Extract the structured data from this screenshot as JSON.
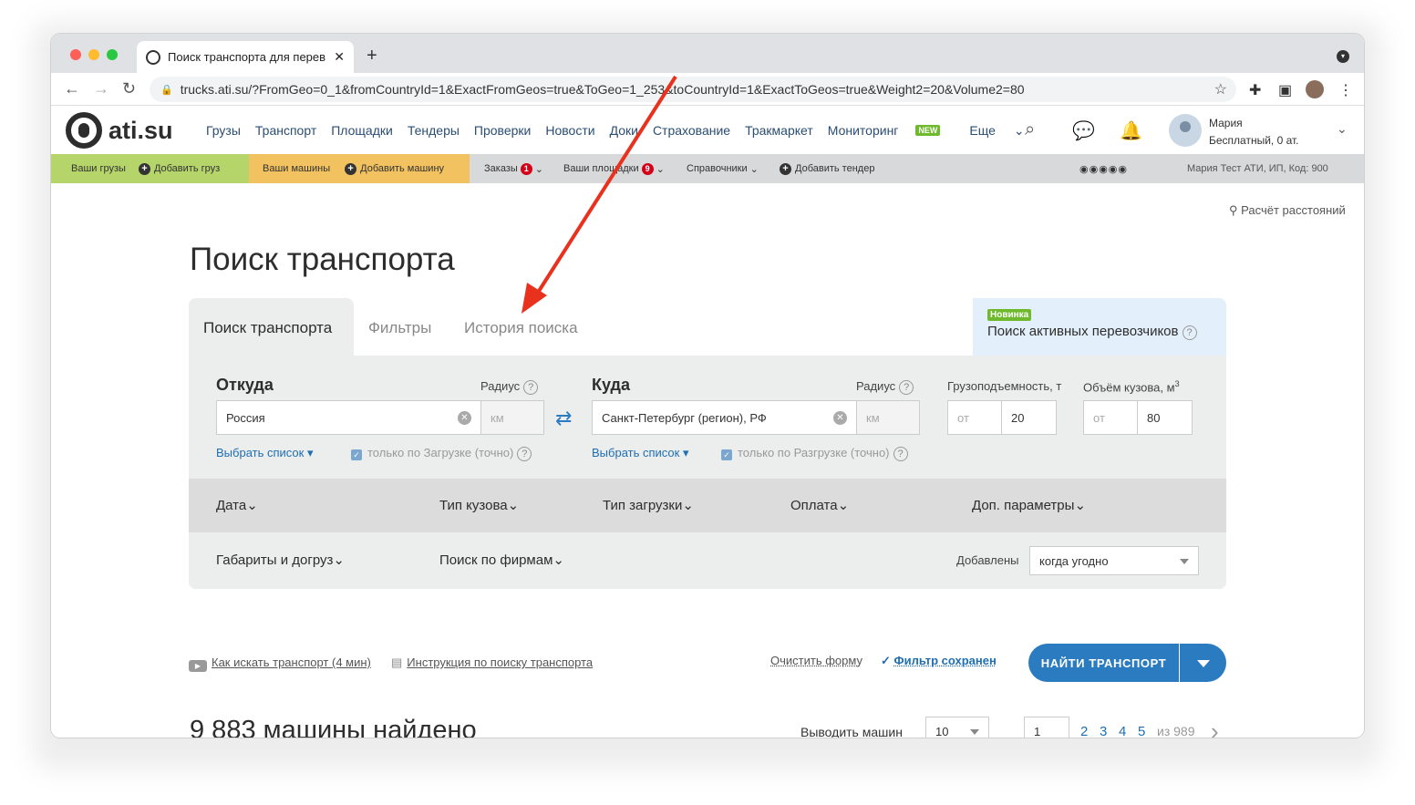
{
  "browser": {
    "tab_title": "Поиск транспорта для перев",
    "tab_close": "✕",
    "new_tab": "+",
    "url": "trucks.ati.su/?FromGeo=0_1&fromCountryId=1&ExactFromGeos=true&ToGeo=1_253&toCountryId=1&ExactToGeos=true&Weight2=20&Volume2=80"
  },
  "site": {
    "logo": "ati.su",
    "nav": [
      "Грузы",
      "Транспорт",
      "Площадки",
      "Тендеры",
      "Проверки",
      "Новости",
      "Доки",
      "Страхование",
      "Тракмаркет",
      "Мониторинг"
    ],
    "new_badge": "NEW",
    "more": "Еще",
    "user_name": "Мария",
    "user_plan": "Бесплатный,   0 ат."
  },
  "subbar": {
    "your_cargo": "Ваши грузы",
    "add_cargo": "Добавить груз",
    "your_trucks": "Ваши машины",
    "add_truck": "Добавить машину",
    "orders": "Заказы",
    "orders_count": "1",
    "platforms": "Ваши площадки",
    "platforms_count": "9",
    "references": "Справочники",
    "add_tender": "Добавить тендер",
    "company": "Мария Тест АТИ, ИП,   Код: 900"
  },
  "page": {
    "distance_calc": "Расчёт расстояний",
    "title": "Поиск транспорта",
    "tabs": [
      "Поиск транспорта",
      "Фильтры",
      "История поиска"
    ],
    "new_label": "Новинка",
    "active_carriers": "Поиск активных перевозчиков"
  },
  "form": {
    "from_label": "Откуда",
    "to_label": "Куда",
    "radius_label": "Радиус",
    "from_value": "Россия",
    "to_value": "Санкт-Петербург (регион), РФ",
    "km_placeholder": "км",
    "select_list": "Выбрать список",
    "only_loading": "только по Загрузке (точно)",
    "only_unloading": "только по Разгрузке (точно)",
    "capacity_label": "Грузоподъемность, т",
    "volume_label": "Объём кузова, м",
    "volume_sup": "3",
    "from_placeholder": "от",
    "capacity_value": "20",
    "volume_value": "80"
  },
  "filters": {
    "date": "Дата",
    "body_type": "Тип кузова",
    "loading_type": "Тип загрузки",
    "payment": "Оплата",
    "extra": "Доп. параметры",
    "dimensions": "Габариты и догруз",
    "firms": "Поиск по фирмам",
    "added_label": "Добавлены",
    "added_value": "когда угодно"
  },
  "actions": {
    "how_to": "Как искать транспорт (4 мин)",
    "instruction": "Инструкция по поиску транспорта",
    "clear_form": "Очистить форму",
    "filter_saved": "Фильтр сохранен",
    "find_button": "НАЙТИ ТРАНСПОРТ"
  },
  "results": {
    "count_text": "9 883 машины найдено",
    "per_page_label": "Выводить машин",
    "per_page_value": "10",
    "page_value": "1",
    "pages": [
      "2",
      "3",
      "4",
      "5"
    ],
    "of_total": "из 989"
  },
  "colors": {
    "green_section": "#b5d46a",
    "yellow_section": "#f2c260",
    "accent_blue": "#2b7bc0",
    "arrow_red": "#e8321e"
  }
}
